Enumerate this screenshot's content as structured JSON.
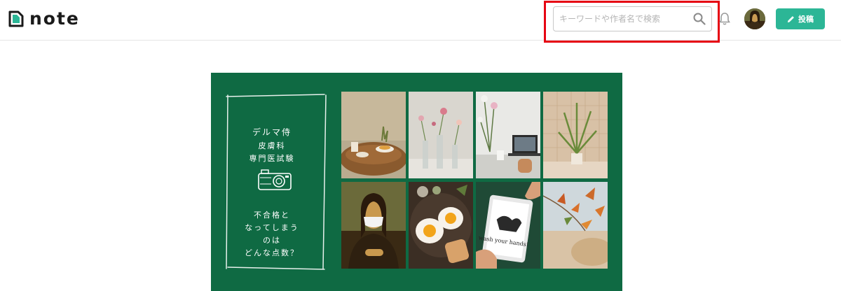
{
  "header": {
    "logo_text": "note",
    "search": {
      "placeholder": "キーワードや作者名で検索",
      "value": ""
    },
    "post_button_label": "投稿"
  },
  "banner": {
    "title_lines": [
      "デルマ侍",
      "皮膚科",
      "専門医試験"
    ],
    "question_lines": [
      "不合格と",
      "なってしまう",
      "のは",
      "どんな点数？"
    ],
    "tile_icons": [
      "breakfast-table-photo",
      "flower-vases-photo",
      "workspace-laptop-photo",
      "palm-plant-photo",
      "mona-lisa-mask-photo",
      "fried-eggs-photo",
      "wash-hands-tablet-photo",
      "autumn-leaves-photo"
    ],
    "tablet_text": "wash your hands!",
    "background_color": "#0f6a43"
  },
  "colors": {
    "accent": "#2cb696",
    "highlight": "#e60012"
  }
}
